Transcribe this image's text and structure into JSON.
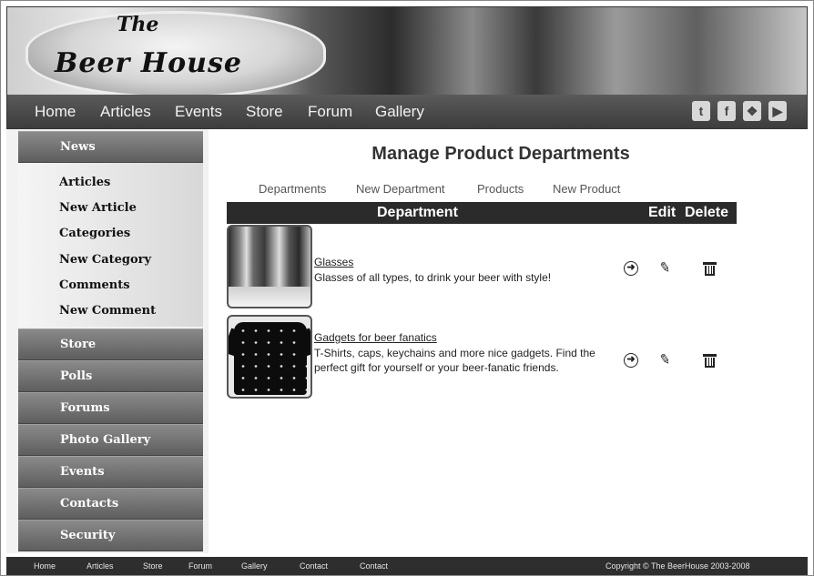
{
  "site": {
    "logo_the": "The",
    "logo_main": "Beer House"
  },
  "top_nav": [
    "Home",
    "Articles",
    "Events",
    "Store",
    "Forum",
    "Gallery"
  ],
  "social_icons": [
    "twitter-icon",
    "facebook-icon",
    "delicious-icon",
    "youtube-icon"
  ],
  "sidebar": {
    "sections": [
      "News",
      "Store",
      "Polls",
      "Forums",
      "Photo Gallery",
      "Events",
      "Contacts",
      "Security"
    ],
    "news_items": [
      "Articles",
      "New Article",
      "Categories",
      "New Category",
      "Comments",
      "New Comment"
    ]
  },
  "main": {
    "title": "Manage Product Departments",
    "subnav": [
      "Departments",
      "New Department",
      "Products",
      "New Product"
    ],
    "table": {
      "col_department": "Department",
      "col_edit": "Edit",
      "col_delete": "Delete",
      "rows": [
        {
          "name": "Glasses",
          "description": "Glasses of all types, to drink your beer with style!"
        },
        {
          "name": "Gadgets for beer fanatics",
          "description": "T-Shirts, caps, keychains and more nice gadgets. Find the perfect gift for yourself or your beer-fanatic friends."
        }
      ]
    }
  },
  "footer": {
    "links": [
      "Home",
      "Articles",
      "Store",
      "Forum",
      "Gallery",
      "Contact",
      "Contact"
    ],
    "copyright": "Copyright © The BeerHouse 2003-2008"
  },
  "colors": {
    "nav_bar": "#3c3c3c",
    "sidebar_head": "#5e5e5e",
    "table_head": "#2b2b2b",
    "footer": "#2e2e2e"
  }
}
